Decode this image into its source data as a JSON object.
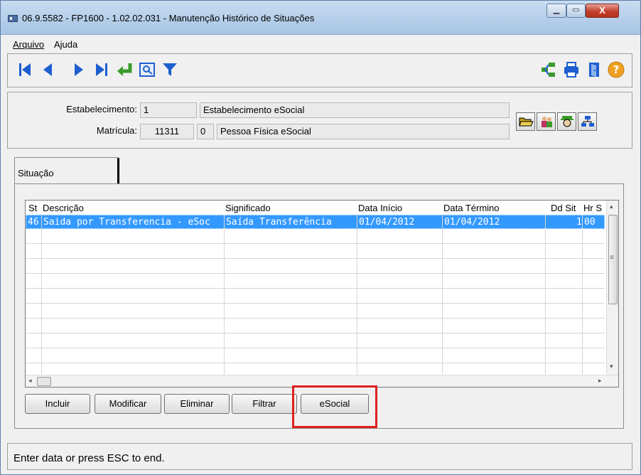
{
  "window": {
    "title": "06.9.5582 - FP1600 - 1.02.02.031 - Manutenção Histórico de Situações",
    "minimize_glyph": "▁",
    "maximize_glyph": "▭",
    "close_glyph": "X"
  },
  "menu": {
    "items": [
      {
        "label": "Arquivo"
      },
      {
        "label": "Ajuda"
      }
    ]
  },
  "toolbar": {
    "icons": [
      "first-record-icon",
      "previous-record-icon",
      "next-record-icon",
      "last-record-icon",
      "go-to-icon",
      "search-icon",
      "filter-icon",
      "relationships-icon",
      "print-icon",
      "exit-icon",
      "help-icon"
    ],
    "help_glyph": "?"
  },
  "header": {
    "estabelecimento_label": "Estabelecimento:",
    "estabelecimento_code": "1",
    "estabelecimento_name": "Estabelecimento eSocial",
    "matricula_label": "Matrícula:",
    "matricula_code": "11311",
    "matricula_digit": "0",
    "matricula_name": "Pessoa Física eSocial"
  },
  "tabs": [
    {
      "label": "Situação",
      "active": true
    }
  ],
  "grid": {
    "columns": [
      "St",
      "Descrição",
      "Significado",
      "Data Início",
      "Data Término",
      "Dd Sit",
      "Hr S"
    ],
    "rows": [
      {
        "st": "46",
        "descricao": "Saida por Transferencia - eSoc",
        "significado": "Saída Transferência",
        "data_inicio": "01/04/2012",
        "data_termino": "01/04/2012",
        "dd_sit": "1",
        "hr_s": "00",
        "selected": true
      }
    ],
    "scroll_left": "◂",
    "scroll_right": "▸",
    "scroll_up": "▴",
    "scroll_down": "▾",
    "scroll_grip": "≡"
  },
  "actions": {
    "incluir": "Incluir",
    "modificar": "Modificar",
    "eliminar": "Eliminar",
    "filtrar": "Filtrar",
    "esocial": "eSocial"
  },
  "status": {
    "text": "Enter data or press ESC to end."
  },
  "colors": {
    "selection": "#3399ff",
    "highlight": "#e02020",
    "toolbar_blue": "#1e5fd0",
    "toolbar_green": "#3a9a2a"
  }
}
